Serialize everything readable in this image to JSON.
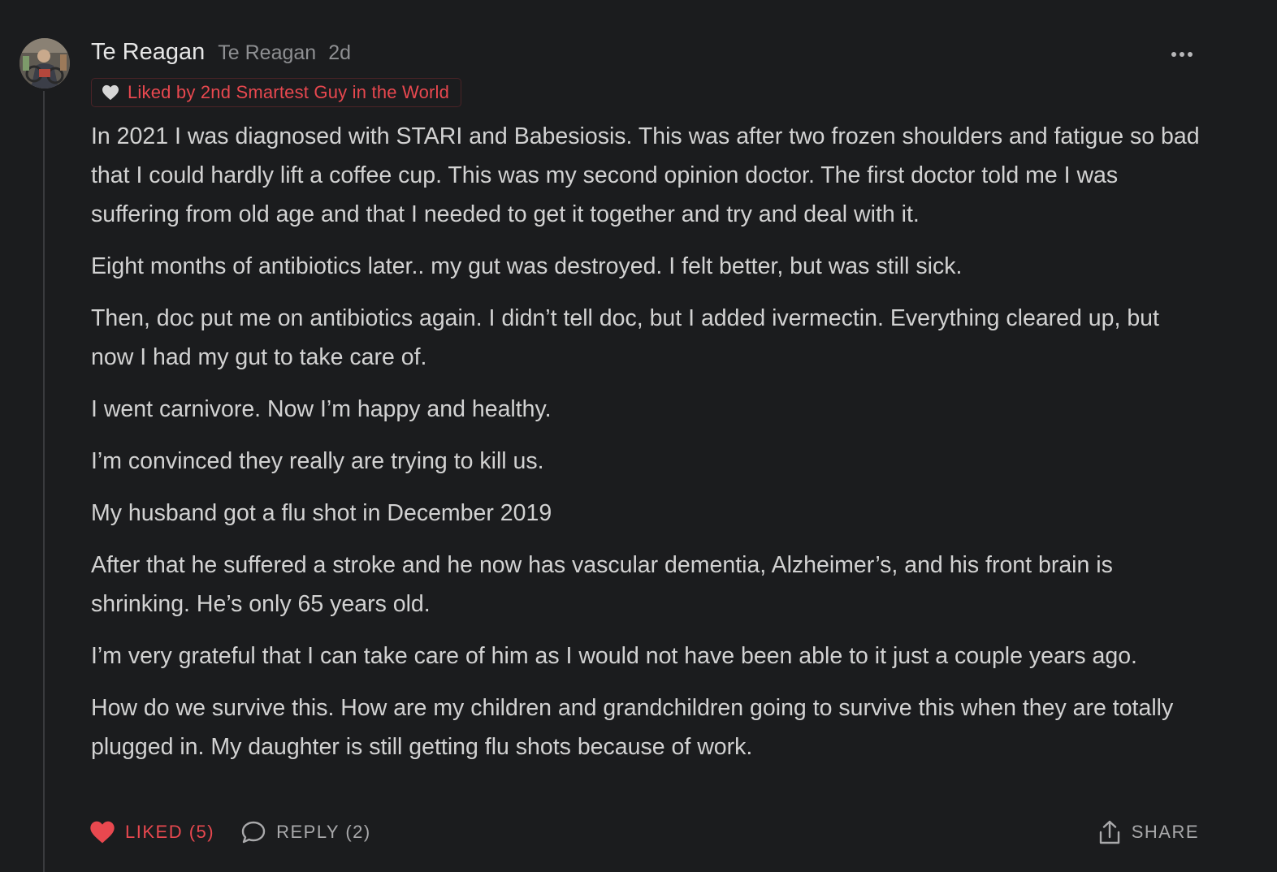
{
  "comment": {
    "author_name": "Te Reagan",
    "author_handle": "Te Reagan",
    "timestamp": "2d",
    "more_icon": "more-horizontal-icon",
    "liked_badge": {
      "icon": "heart-icon",
      "text": "Liked by 2nd Smartest Guy in the World"
    },
    "paragraphs": [
      "In 2021 I was diagnosed with STARI and Babesiosis. This was after two frozen shoulders and fatigue so bad that I could hardly lift a coffee cup. This was my second opinion doctor. The first doctor told me I was suffering from old age and that I needed to get it together and try and deal with it.",
      "Eight months of antibiotics later.. my gut was destroyed. I felt better, but was still sick.",
      "Then, doc put me on antibiotics again. I didn’t tell doc, but I added ivermectin. Everything cleared up, but now I had my gut to take care of.",
      "I went carnivore. Now I’m happy and healthy.",
      "I’m convinced they really are trying to kill us.",
      "My husband got a flu shot in December 2019",
      "After that he suffered a stroke and he now has vascular dementia, Alzheimer’s, and his front brain is shrinking. He’s only 65 years old.",
      "I’m very grateful that I can take care of him as I would not have been able to it just a couple years ago.",
      "How do we survive this. How are my children and grandchildren going to survive this when they are totally plugged in. My daughter is still getting flu shots because of work."
    ],
    "actions": {
      "like_label": "LIKED (5)",
      "reply_label": "REPLY (2)",
      "share_label": "SHARE"
    }
  },
  "colors": {
    "background": "#1b1c1e",
    "text": "#d2d2d2",
    "muted": "#8e8f92",
    "accent_red": "#e8484f",
    "thread_line": "#3a3b3e"
  }
}
